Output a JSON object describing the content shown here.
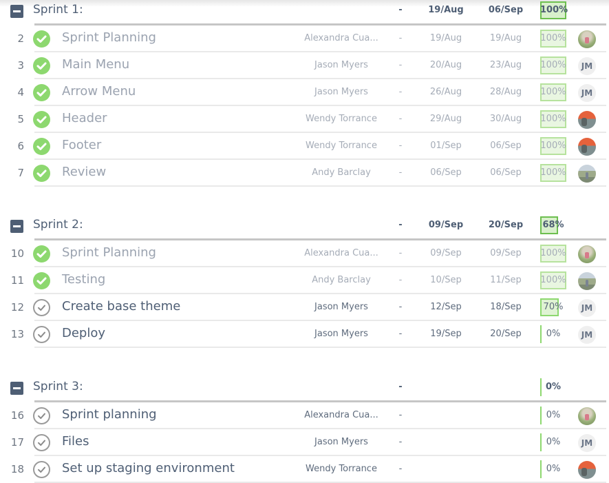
{
  "colors": {
    "accent_green": "#8dd86f",
    "header_text": "#4e5e74",
    "muted_text": "#a5acb7"
  },
  "groups": [
    {
      "title": "Sprint 1:",
      "dash": "-",
      "start": "19/Aug",
      "end": "06/Sep",
      "progress_label": "100%",
      "progress": 100,
      "tasks": [
        {
          "num": "2",
          "name": "Sprint Planning",
          "assignee": "Alexandra Cua...",
          "dash": "-",
          "start": "19/Aug",
          "end": "19/Aug",
          "progress_label": "100%",
          "progress": 100,
          "done": true,
          "avatar": "photo-a",
          "avatar_text": ""
        },
        {
          "num": "3",
          "name": "Main Menu",
          "assignee": "Jason Myers",
          "dash": "-",
          "start": "20/Aug",
          "end": "23/Aug",
          "progress_label": "100%",
          "progress": 100,
          "done": true,
          "avatar": "initials",
          "avatar_text": "JM"
        },
        {
          "num": "4",
          "name": "Arrow Menu",
          "assignee": "Jason Myers",
          "dash": "-",
          "start": "26/Aug",
          "end": "28/Aug",
          "progress_label": "100%",
          "progress": 100,
          "done": true,
          "avatar": "initials",
          "avatar_text": "JM"
        },
        {
          "num": "5",
          "name": "Header",
          "assignee": "Wendy Torrance",
          "dash": "-",
          "start": "29/Aug",
          "end": "30/Aug",
          "progress_label": "100%",
          "progress": 100,
          "done": true,
          "avatar": "photo-w",
          "avatar_text": ""
        },
        {
          "num": "6",
          "name": "Footer",
          "assignee": "Wendy Torrance",
          "dash": "-",
          "start": "01/Sep",
          "end": "06/Sep",
          "progress_label": "100%",
          "progress": 100,
          "done": true,
          "avatar": "photo-w",
          "avatar_text": ""
        },
        {
          "num": "7",
          "name": "Review",
          "assignee": "Andy Barclay",
          "dash": "-",
          "start": "06/Sep",
          "end": "06/Sep",
          "progress_label": "100%",
          "progress": 100,
          "done": true,
          "avatar": "photo-b",
          "avatar_text": ""
        }
      ]
    },
    {
      "title": "Sprint 2:",
      "dash": "-",
      "start": "09/Sep",
      "end": "20/Sep",
      "progress_label": "68%",
      "progress": 68,
      "tasks": [
        {
          "num": "10",
          "name": "Sprint Planning",
          "assignee": "Alexandra Cua...",
          "dash": "-",
          "start": "09/Sep",
          "end": "09/Sep",
          "progress_label": "100%",
          "progress": 100,
          "done": true,
          "avatar": "photo-a",
          "avatar_text": ""
        },
        {
          "num": "11",
          "name": "Testing",
          "assignee": "Andy Barclay",
          "dash": "-",
          "start": "10/Sep",
          "end": "11/Sep",
          "progress_label": "100%",
          "progress": 100,
          "done": true,
          "avatar": "photo-b",
          "avatar_text": ""
        },
        {
          "num": "12",
          "name": "Create base theme",
          "assignee": "Jason Myers",
          "dash": "-",
          "start": "12/Sep",
          "end": "18/Sep",
          "progress_label": "70%",
          "progress": 70,
          "done": false,
          "avatar": "initials",
          "avatar_text": "JM"
        },
        {
          "num": "13",
          "name": "Deploy",
          "assignee": "Jason Myers",
          "dash": "-",
          "start": "19/Sep",
          "end": "20/Sep",
          "progress_label": "0%",
          "progress": 0,
          "done": false,
          "avatar": "initials",
          "avatar_text": "JM"
        }
      ]
    },
    {
      "title": "Sprint 3:",
      "dash": "-",
      "start": "",
      "end": "",
      "progress_label": "0%",
      "progress": 0,
      "tasks": [
        {
          "num": "16",
          "name": "Sprint planning",
          "assignee": "Alexandra Cua...",
          "dash": "-",
          "start": "",
          "end": "",
          "progress_label": "0%",
          "progress": 0,
          "done": false,
          "avatar": "photo-a",
          "avatar_text": ""
        },
        {
          "num": "17",
          "name": "Files",
          "assignee": "Jason Myers",
          "dash": "-",
          "start": "",
          "end": "",
          "progress_label": "0%",
          "progress": 0,
          "done": false,
          "avatar": "initials",
          "avatar_text": "JM"
        },
        {
          "num": "18",
          "name": "Set up staging environment",
          "assignee": "Wendy Torrance",
          "dash": "-",
          "start": "",
          "end": "",
          "progress_label": "0%",
          "progress": 0,
          "done": false,
          "avatar": "photo-w",
          "avatar_text": ""
        }
      ]
    }
  ]
}
